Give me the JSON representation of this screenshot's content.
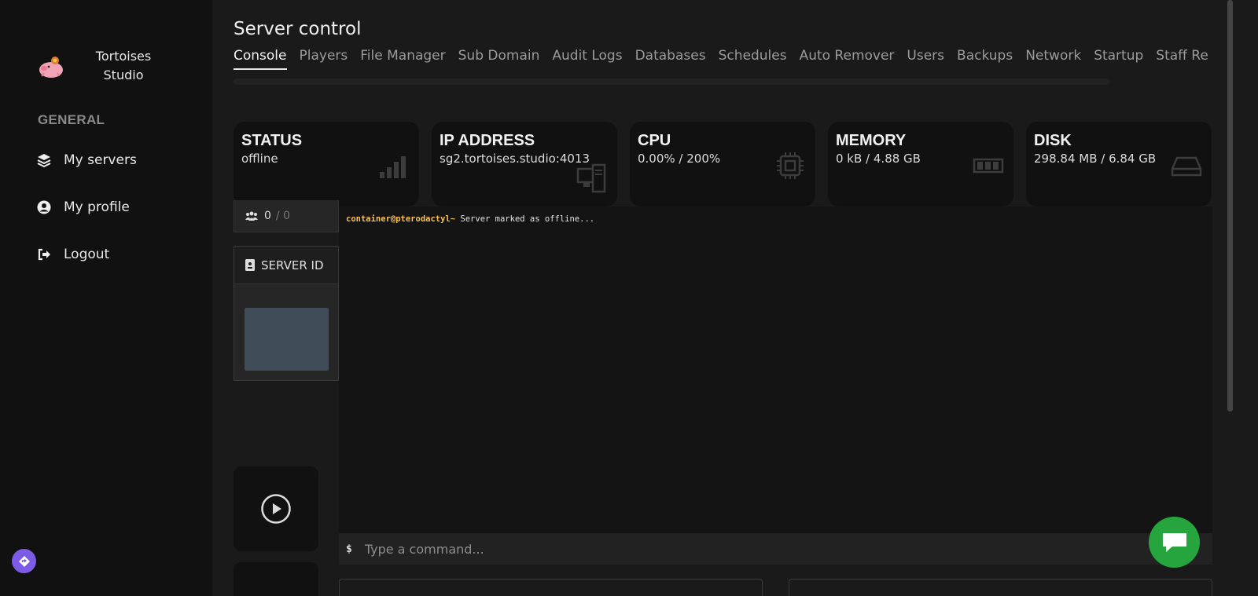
{
  "brand": {
    "name": "Tortoises Studio",
    "logo_icon": "pig-mascot-icon"
  },
  "sidebar": {
    "section_label": "GENERAL",
    "items": [
      {
        "label": "My servers",
        "icon": "layers-icon"
      },
      {
        "label": "My profile",
        "icon": "user-circle-icon"
      },
      {
        "label": "Logout",
        "icon": "logout-icon"
      }
    ]
  },
  "header": {
    "title": "Server control"
  },
  "tabs": [
    {
      "label": "Console",
      "active": true
    },
    {
      "label": "Players"
    },
    {
      "label": "File Manager"
    },
    {
      "label": "Sub Domain"
    },
    {
      "label": "Audit Logs"
    },
    {
      "label": "Databases"
    },
    {
      "label": "Schedules"
    },
    {
      "label": "Auto Remover"
    },
    {
      "label": "Users"
    },
    {
      "label": "Backups"
    },
    {
      "label": "Network"
    },
    {
      "label": "Startup"
    },
    {
      "label": "Staff Re"
    }
  ],
  "stats": [
    {
      "label": "STATUS",
      "value": "offline",
      "icon": "signal-bars-icon"
    },
    {
      "label": "IP ADDRESS",
      "value": "sg2.tortoises.studio:4013",
      "icon": "desktop-tower-icon"
    },
    {
      "label": "CPU",
      "value": "0.00% / 200%",
      "icon": "cpu-chip-icon"
    },
    {
      "label": "MEMORY",
      "value": "0 kB / 4.88 GB",
      "icon": "memory-module-icon"
    },
    {
      "label": "DISK",
      "value": "298.84 MB / 6.84 GB",
      "icon": "hard-drive-icon"
    }
  ],
  "players": {
    "current": "0",
    "max": "/ 0",
    "icon": "users-icon"
  },
  "server_id": {
    "label": "SERVER ID",
    "icon": "id-badge-icon"
  },
  "console": {
    "prompt": "container@pterodactyl~",
    "message": "Server marked as offline..."
  },
  "command": {
    "dollar": "$",
    "placeholder": "Type a command..."
  },
  "colors": {
    "accent_prompt": "#f6c04f",
    "chat_fab": "#26a43e",
    "badge_fab": "#7c5ce6"
  }
}
